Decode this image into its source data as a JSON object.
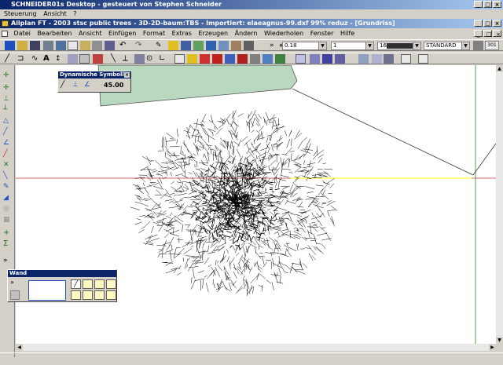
{
  "desktop": {
    "title": "SCHNEIDER01s Desktop - gesteuert von Stephen Schneider",
    "menu": [
      "Steuerung",
      "Ansicht",
      "?"
    ]
  },
  "app": {
    "title": "Allplan FT - 2003 stsc public trees - 3D-2D-baum:TBS - Importiert: elaeagnus-99.dxf   99% reduz - [Grundriss]",
    "menu": [
      "Datei",
      "Bearbeiten",
      "Ansicht",
      "Einfügen",
      "Format",
      "Extras",
      "Erzeugen",
      "Ändern",
      "Wiederholen",
      "Fenster",
      "Hilfe"
    ],
    "pen_thickness": "0.18",
    "line_type": "1",
    "color_number": "16",
    "layer": "STANDARD",
    "scale_badge": "301"
  },
  "dyn_palette": {
    "title": "Dynamische Symbolleiste",
    "title_display": "Dynamische Symboll...",
    "angle_value": "45.00"
  },
  "wand_palette": {
    "title": "Wand"
  },
  "window_controls": {
    "minimize": "_",
    "maximize": "□",
    "close": "×"
  },
  "colors": {
    "title_active": "#0a246a",
    "title_gradient_end": "#a6caf0",
    "canvas": "#ffffff",
    "plant_fill": "#b8d8c0",
    "axis_red": "#cc3333",
    "axis_yellow": "#ffff00",
    "axis_green": "#2a8a2a",
    "tree_stroke": "#000000"
  }
}
